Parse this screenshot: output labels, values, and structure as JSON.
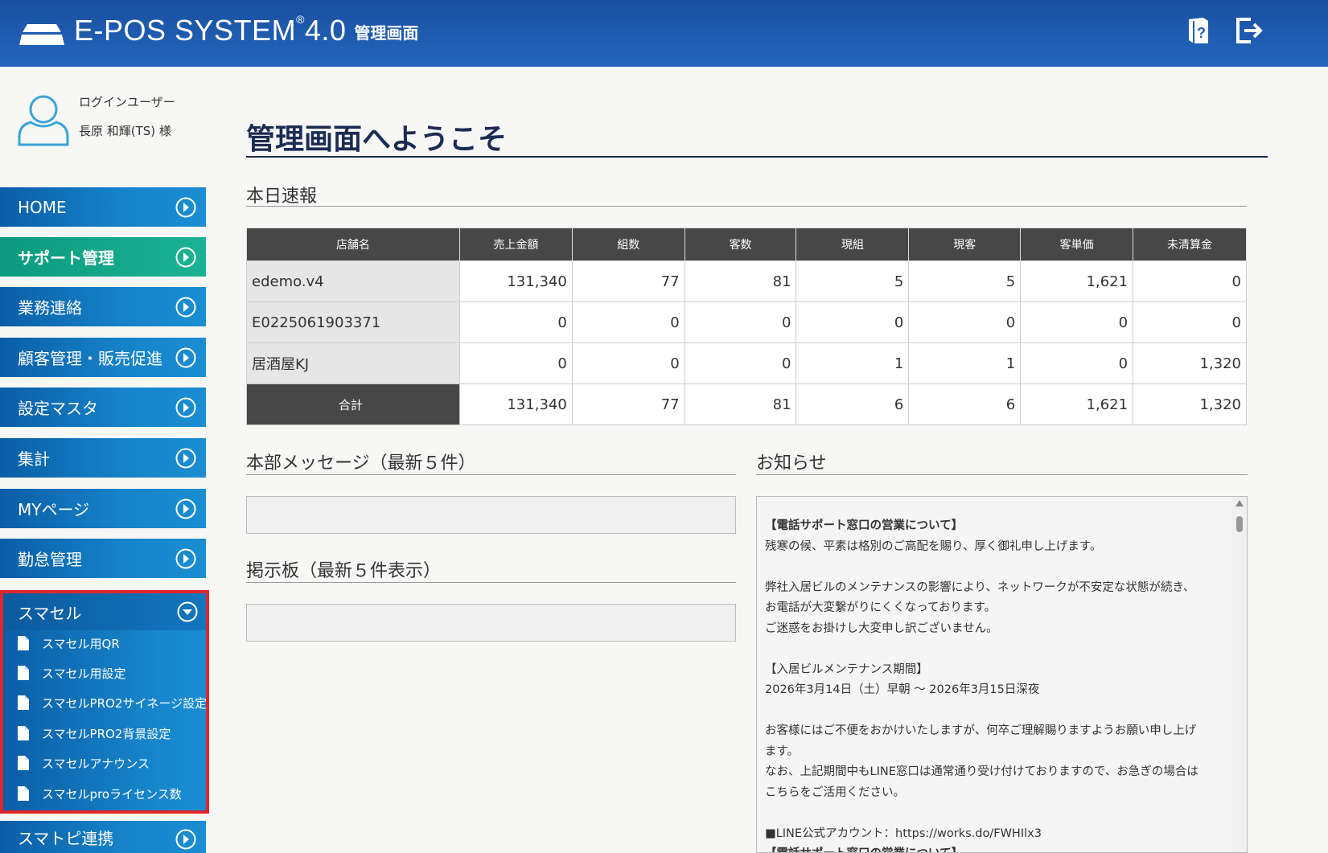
{
  "header": {
    "logo_text": "E-POS SYSTEM",
    "logo_reg": "®",
    "logo_version": "4.0",
    "subtitle": "管理画面",
    "icons": [
      "help-manual-icon",
      "logout-icon"
    ]
  },
  "user": {
    "label": "ログインユーザー",
    "name": "長原 和輝(TS) 様",
    "icon": "user-avatar-icon"
  },
  "sidebar": {
    "items": [
      {
        "label": "HOME"
      },
      {
        "label": "サポート管理"
      },
      {
        "label": "業務連絡"
      },
      {
        "label": "顧客管理・販売促進"
      },
      {
        "label": "設定マスタ"
      },
      {
        "label": "集計"
      },
      {
        "label": "MYページ"
      },
      {
        "label": "勤怠管理"
      }
    ],
    "smacel": {
      "label": "スマセル",
      "subitems": [
        {
          "label": "スマセル用QR"
        },
        {
          "label": "スマセル用設定"
        },
        {
          "label": "スマセルPRO2サイネージ設定"
        },
        {
          "label": "スマセルPRO2背景設定"
        },
        {
          "label": "スマセルアナウンス"
        },
        {
          "label": "スマセルproライセンス数"
        }
      ]
    },
    "after": {
      "label": "スマトピ連携"
    }
  },
  "main": {
    "title": "管理画面へようこそ",
    "report": {
      "section_title": "本日速報",
      "headers": [
        "店舗名",
        "売上金額",
        "組数",
        "客数",
        "現組",
        "現客",
        "客単価",
        "未清算金"
      ],
      "rows": [
        [
          "edemo.v4",
          "131,340",
          "77",
          "81",
          "5",
          "5",
          "1,621",
          "0"
        ],
        [
          "E0225061903371",
          "0",
          "0",
          "0",
          "0",
          "0",
          "0",
          "0"
        ],
        [
          "居酒屋KJ",
          "0",
          "0",
          "0",
          "1",
          "1",
          "0",
          "1,320"
        ]
      ],
      "total": [
        "合計",
        "131,340",
        "77",
        "81",
        "6",
        "6",
        "1,621",
        "1,320"
      ]
    },
    "hq_messages": {
      "title": "本部メッセージ（最新５件）"
    },
    "board": {
      "title": "掲示板（最新５件表示）"
    },
    "notices": {
      "title": "お知らせ",
      "lines": [
        "【電話サポート窓口の営業について】",
        "残寒の候、平素は格別のご高配を賜り、厚く御礼申し上げます。",
        "",
        "弊社入居ビルのメンテナンスの影響により、ネットワークが不安定な状態が続き、",
        "お電話が大変繋がりにくくなっております。",
        "ご迷惑をお掛けし大変申し訳ございません。",
        "",
        "【入居ビルメンテナンス期間】",
        "2026年3月14日（土）早朝 〜 2026年3月15日深夜",
        "",
        "お客様にはご不便をおかけいたしますが、何卒ご理解賜りますようお願い申し上げ",
        "ます。",
        "なお、上記期間中もLINE窓口は通常通り受け付けておりますので、お急ぎの場合は",
        "こちらをご活用ください。",
        "",
        "■LINE公式アカウント：https://works.do/FWHIlx3",
        "【電話サポート窓口の営業について】"
      ]
    }
  },
  "colors": {
    "header_bg": "#1f5fb3",
    "nav_bg": "#1683c9",
    "nav_active": "#1bb394",
    "highlight_border": "#e0262c",
    "title_color": "#1b2b52",
    "table_header": "#474747"
  }
}
